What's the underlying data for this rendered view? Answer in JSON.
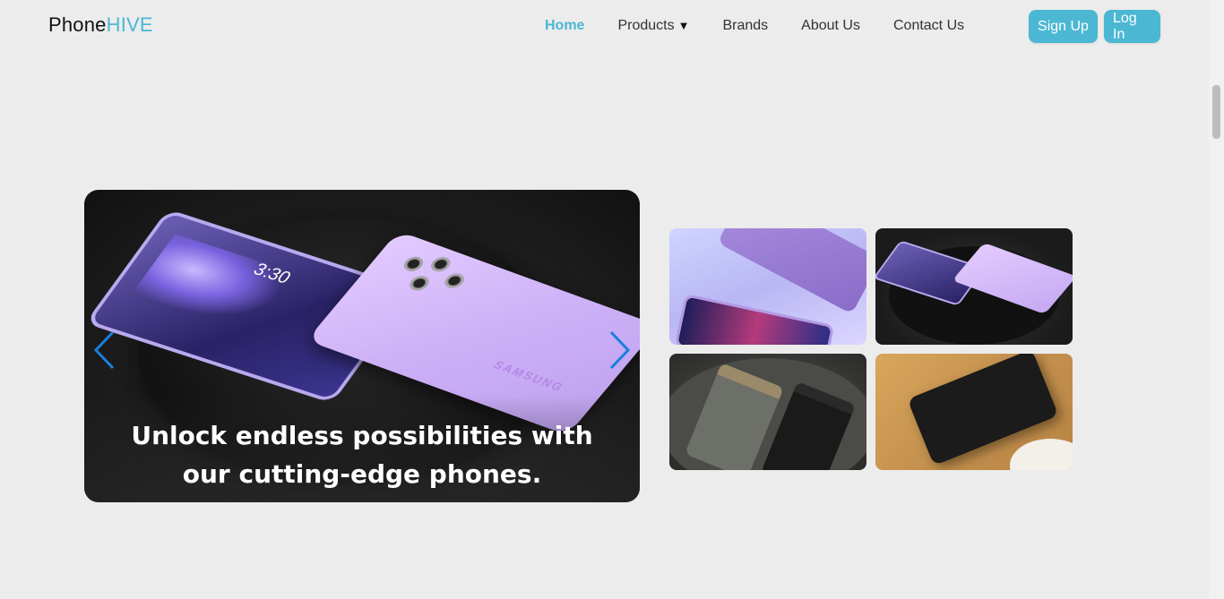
{
  "header": {
    "logo_prefix": "Phone",
    "logo_suffix": "HIVE",
    "nav": {
      "home": "Home",
      "products": "Products",
      "brands": "Brands",
      "about": "About Us",
      "contact": "Contact Us"
    },
    "signup_label": "Sign Up",
    "login_label": "Log In"
  },
  "hero": {
    "caption_line1": "Unlock endless possibilities with",
    "caption_line2": "our cutting-edge phones.",
    "phone_time": "3:30",
    "phone_brand": "SAMSUNG"
  },
  "colors": {
    "accent": "#4bb7d3",
    "background": "#ececec",
    "arrow": "#1a7fe0"
  },
  "icons": {
    "caret": "caret-down-icon",
    "prev": "chevron-left-icon",
    "next": "chevron-right-icon"
  }
}
